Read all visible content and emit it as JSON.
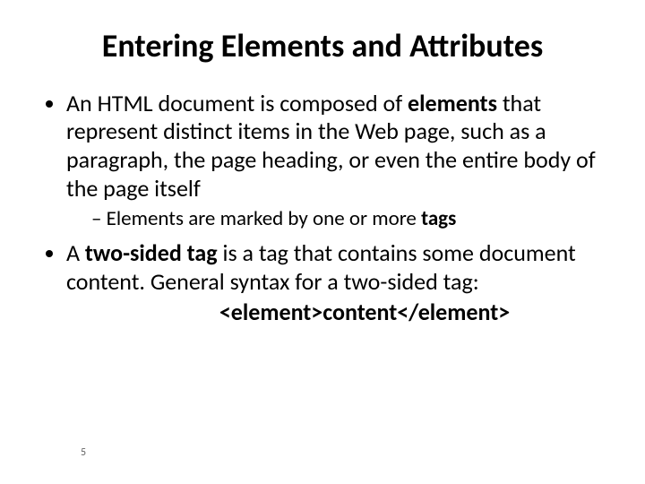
{
  "title": "Entering Elements and Attributes",
  "b1a": "An HTML document is composed of ",
  "b1_bold": "elements",
  "b1b": " that represent distinct items in the Web page, such as a paragraph, the page heading, or even the entire body of the page itself",
  "s1a": "Elements are marked by one or more ",
  "s1_bold": "tags",
  "b2a": "A ",
  "b2_bold": "two-sided tag",
  "b2b": " is a tag that contains some document content.  General syntax for a two-sided tag:",
  "syntax": "<element>content</element>",
  "page": "5"
}
